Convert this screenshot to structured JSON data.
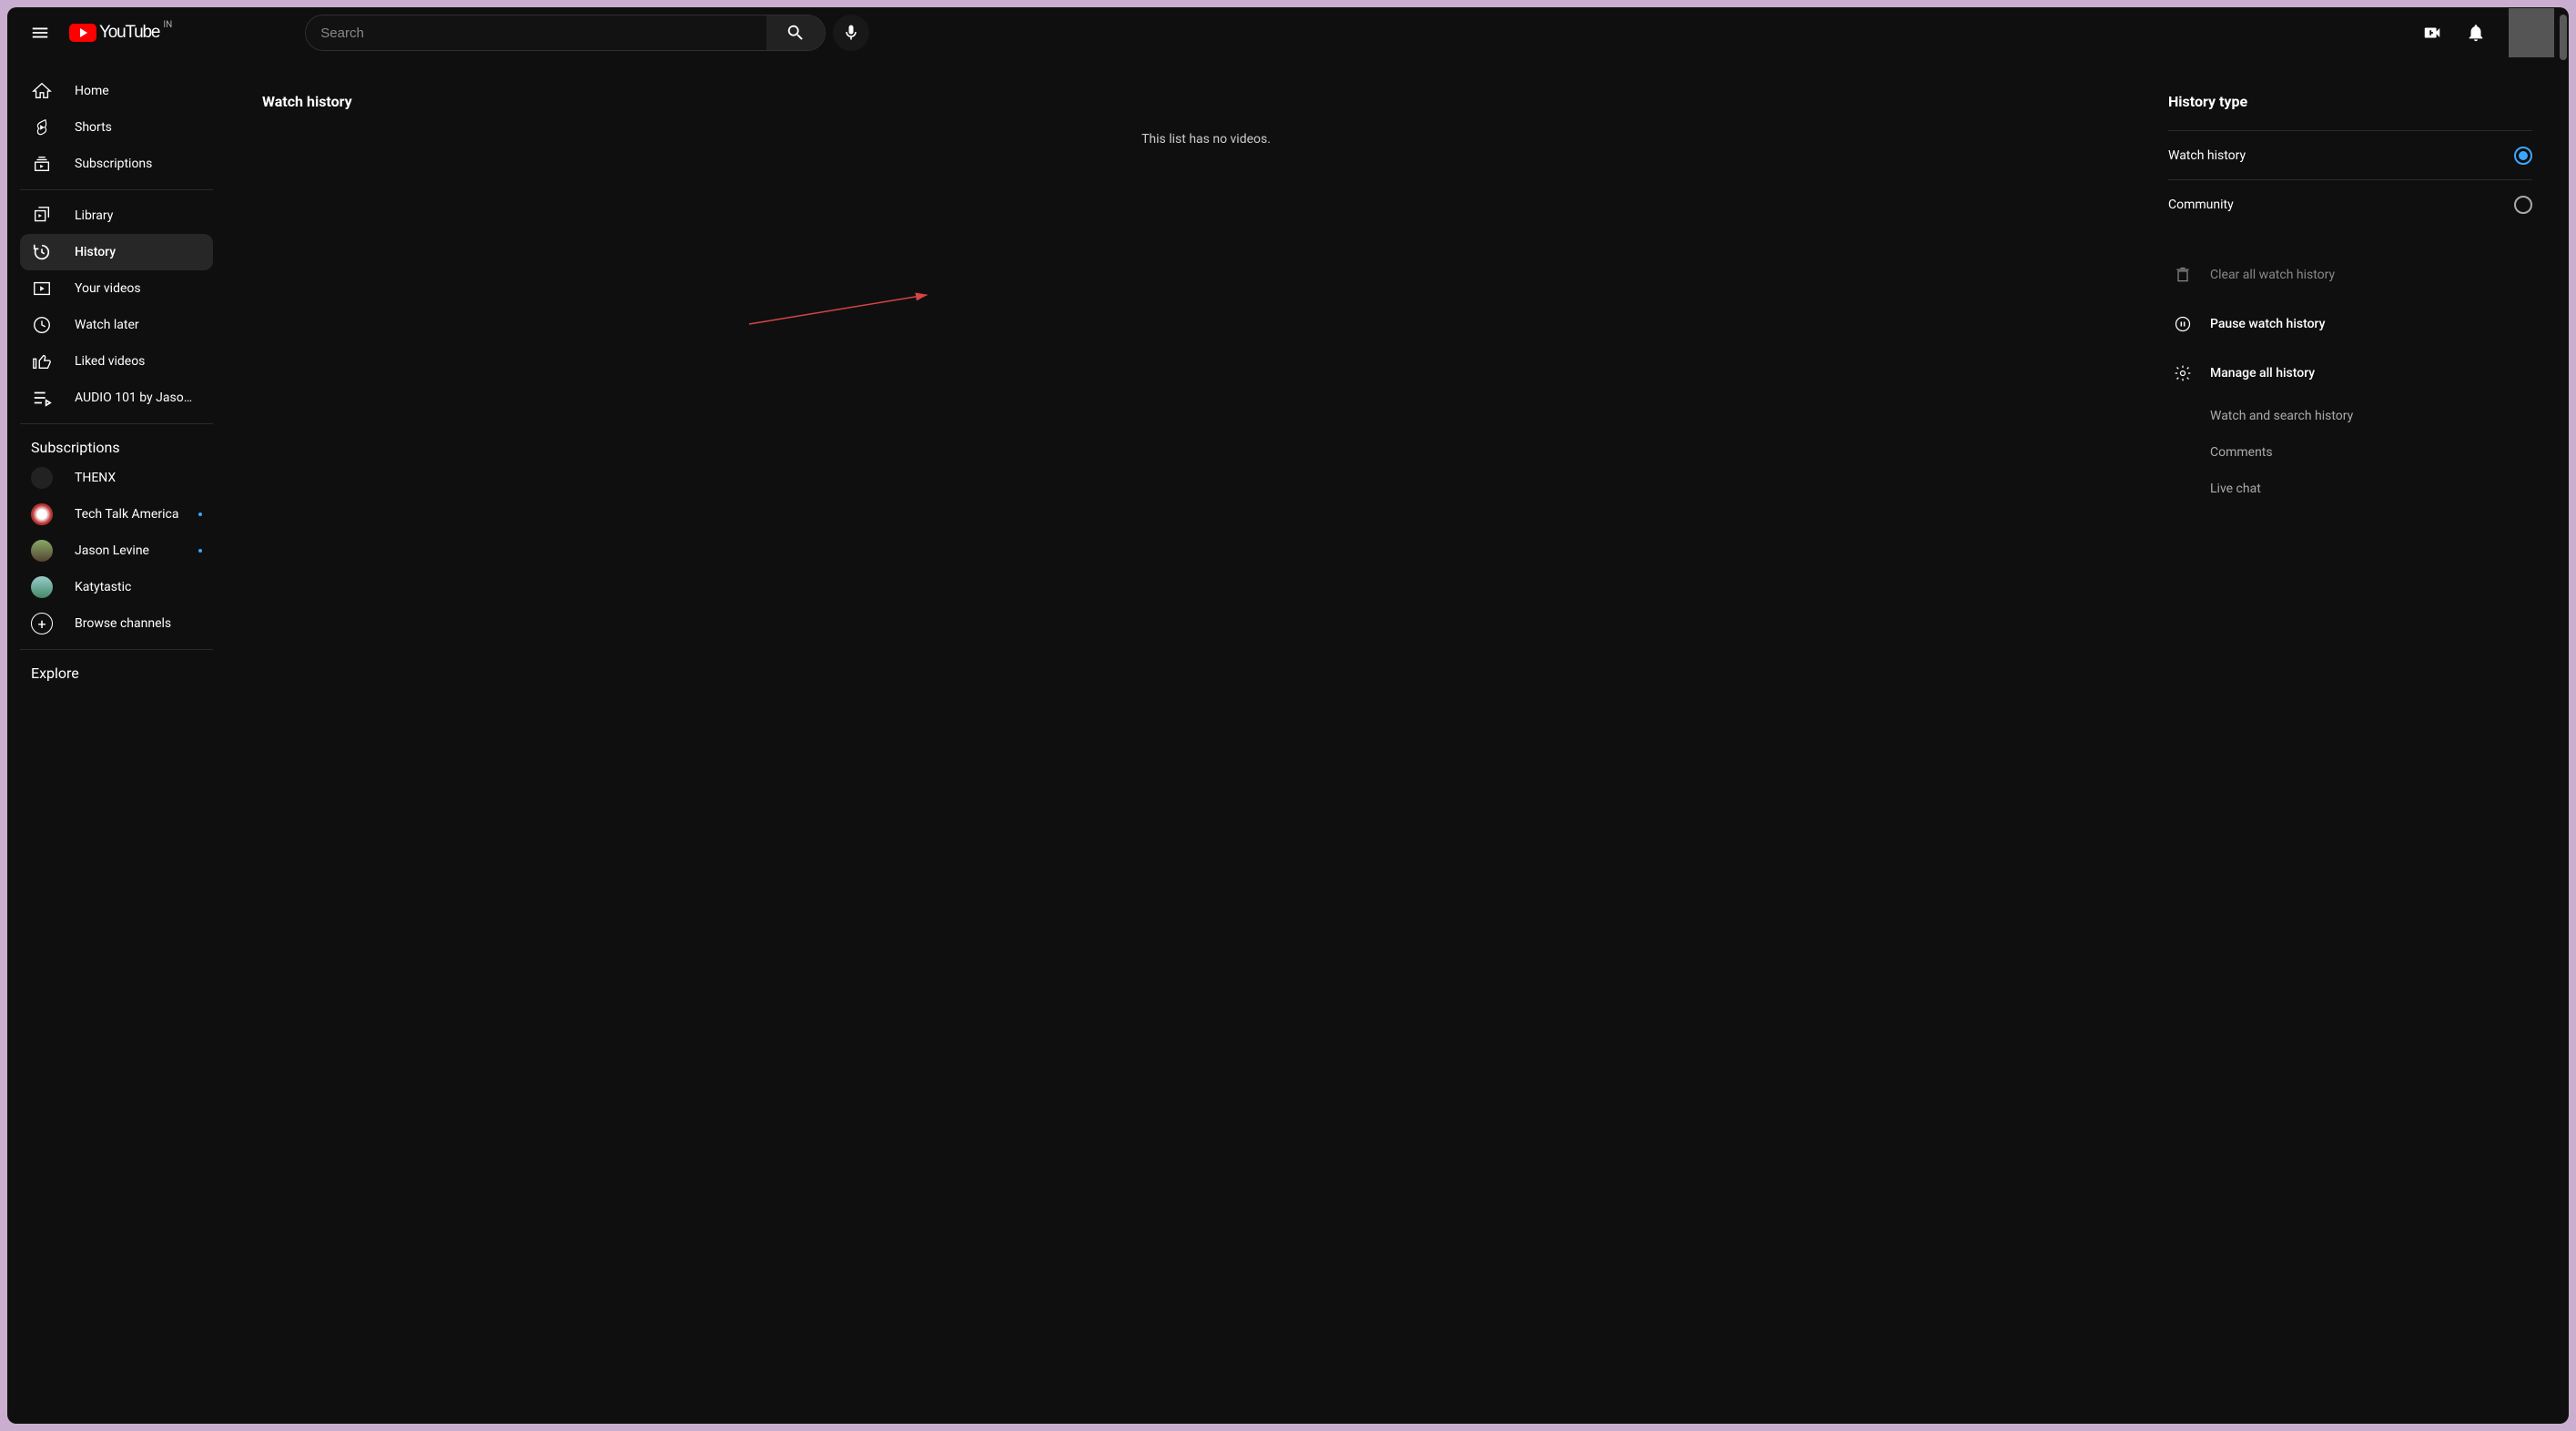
{
  "header": {
    "logo_text": "YouTube",
    "country_code": "IN",
    "search_placeholder": "Search"
  },
  "sidebar": {
    "primary": [
      {
        "label": "Home"
      },
      {
        "label": "Shorts"
      },
      {
        "label": "Subscriptions"
      }
    ],
    "secondary": [
      {
        "label": "Library"
      },
      {
        "label": "History"
      },
      {
        "label": "Your videos"
      },
      {
        "label": "Watch later"
      },
      {
        "label": "Liked videos"
      },
      {
        "label": "AUDIO 101 by Jaso…"
      }
    ],
    "subs_heading": "Subscriptions",
    "subs": [
      {
        "label": "THENX",
        "dot": false
      },
      {
        "label": "Tech Talk America",
        "dot": true
      },
      {
        "label": "Jason Levine",
        "dot": true
      },
      {
        "label": "Katytastic",
        "dot": false
      }
    ],
    "browse": "Browse channels",
    "explore_heading": "Explore"
  },
  "main": {
    "title": "Watch history",
    "empty": "This list has no videos."
  },
  "panel": {
    "title": "History type",
    "radios": [
      {
        "label": "Watch history",
        "checked": true
      },
      {
        "label": "Community",
        "checked": false
      }
    ],
    "clear": "Clear all watch history",
    "pause": "Pause watch history",
    "manage": "Manage all history",
    "links": [
      {
        "label": "Watch and search history"
      },
      {
        "label": "Comments"
      },
      {
        "label": "Live chat"
      }
    ]
  }
}
